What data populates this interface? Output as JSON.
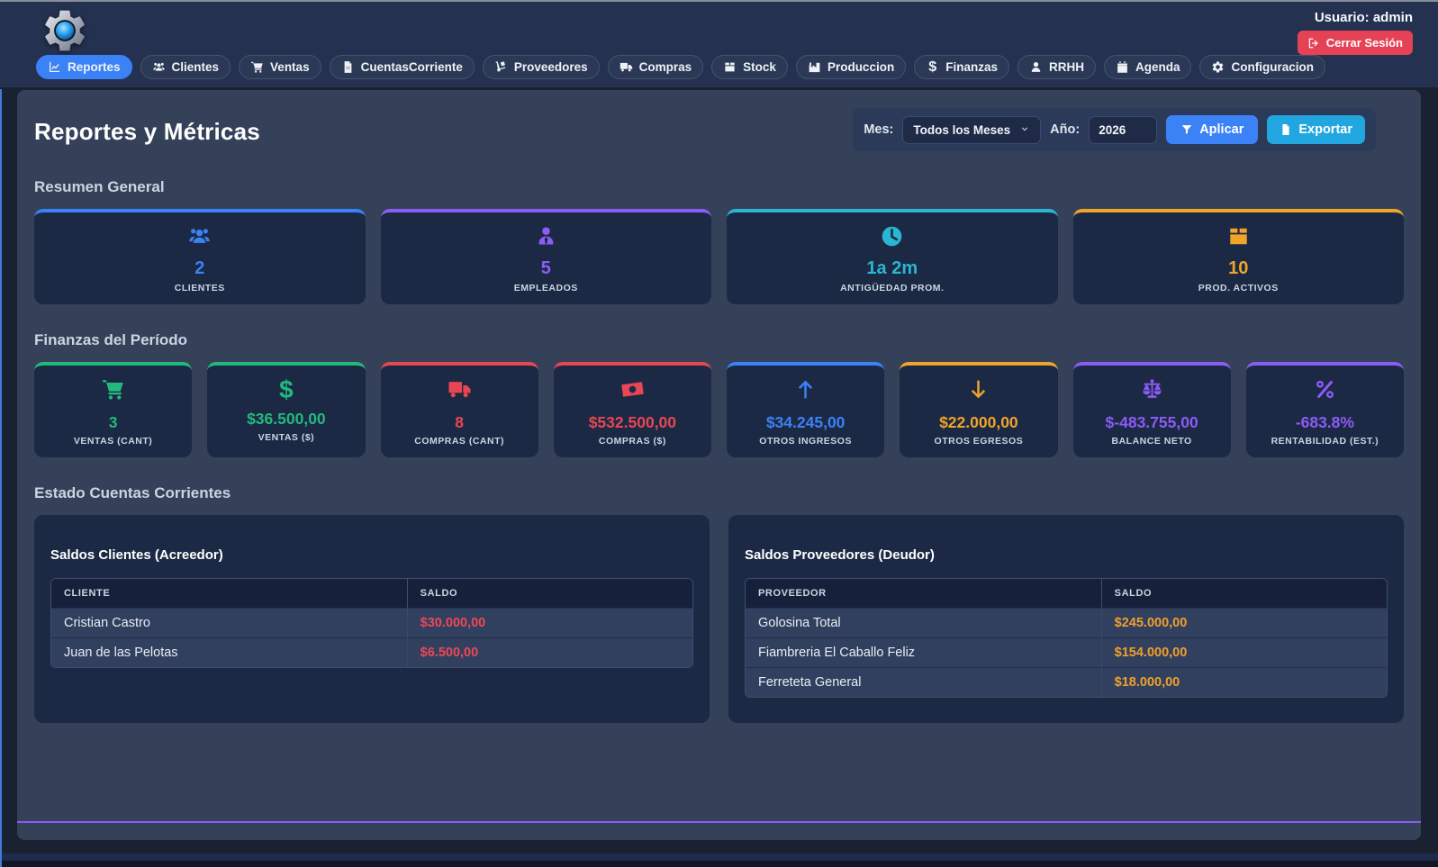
{
  "header": {
    "user_label": "Usuario: admin",
    "logout_label": "Cerrar Sesión",
    "nav": [
      {
        "label": "Reportes",
        "icon": "chart-line",
        "active": true
      },
      {
        "label": "Clientes",
        "icon": "users",
        "active": false
      },
      {
        "label": "Ventas",
        "icon": "cart",
        "active": false
      },
      {
        "label": "CuentasCorriente",
        "icon": "file-invoice",
        "active": false
      },
      {
        "label": "Proveedores",
        "icon": "dolly",
        "active": false
      },
      {
        "label": "Compras",
        "icon": "truck",
        "active": false
      },
      {
        "label": "Stock",
        "icon": "box",
        "active": false
      },
      {
        "label": "Produccion",
        "icon": "industry",
        "active": false
      },
      {
        "label": "Finanzas",
        "icon": "dollar",
        "active": false
      },
      {
        "label": "RRHH",
        "icon": "user",
        "active": false
      },
      {
        "label": "Agenda",
        "icon": "calendar",
        "active": false
      },
      {
        "label": "Configuracion",
        "icon": "gear",
        "active": false
      }
    ]
  },
  "icons": {
    "logout": "logout",
    "filter": "filter",
    "export_pdf": "file-pdf",
    "select_chevron": "chevron-down"
  },
  "colors": {
    "divider_purple": "#8b5cf6",
    "apply_blue": "#3b82f6",
    "export_blue": "#21a6e0",
    "logout_red": "#e64256"
  },
  "page": {
    "title": "Reportes y Métricas",
    "filters": {
      "month_label": "Mes:",
      "month_value": "Todos los Meses",
      "year_label": "Año:",
      "year_value": "2026",
      "apply_label": "Aplicar",
      "export_label": "Exportar"
    },
    "sections": {
      "summary_title": "Resumen General",
      "finance_title": "Finanzas del Período",
      "accounts_title": "Estado Cuentas Corrientes"
    },
    "summary_cards": [
      {
        "icon": "users",
        "value": "2",
        "label": "CLIENTES",
        "color": "#3b82f6"
      },
      {
        "icon": "user-tie",
        "value": "5",
        "label": "EMPLEADOS",
        "color": "#8b5cf6"
      },
      {
        "icon": "clock",
        "value": "1a 2m",
        "label": "ANTIGÜEDAD PROM.",
        "color": "#29b6d2"
      },
      {
        "icon": "box",
        "value": "10",
        "label": "PROD. ACTIVOS",
        "color": "#f0a429"
      }
    ],
    "finance_cards": [
      {
        "icon": "cart",
        "value": "3",
        "label": "VENTAS (CANT)",
        "color": "#22b97c"
      },
      {
        "icon": "dollar",
        "value": "$36.500,00",
        "label": "VENTAS ($)",
        "color": "#22b97c"
      },
      {
        "icon": "truck",
        "value": "8",
        "label": "COMPRAS (CANT)",
        "color": "#e94653"
      },
      {
        "icon": "money-bill",
        "value": "$532.500,00",
        "label": "COMPRAS ($)",
        "color": "#e94653"
      },
      {
        "icon": "arrow-up",
        "value": "$34.245,00",
        "label": "OTROS INGRESOS",
        "color": "#3b82f6"
      },
      {
        "icon": "arrow-down",
        "value": "$22.000,00",
        "label": "OTROS EGRESOS",
        "color": "#f0a429"
      },
      {
        "icon": "balance-scale",
        "value": "$-483.755,00",
        "label": "BALANCE NETO",
        "color": "#8b5cf6"
      },
      {
        "icon": "percent",
        "value": "-683.8%",
        "label": "RENTABILIDAD (EST.)",
        "color": "#8b5cf6"
      }
    ],
    "tables": [
      {
        "title": "Saldos Clientes (Acreedor)",
        "columns": [
          "CLIENTE",
          "SALDO"
        ],
        "amount_color": "#ee4757",
        "rows": [
          [
            "Cristian Castro",
            "$30.000,00"
          ],
          [
            "Juan de las Pelotas",
            "$6.500,00"
          ]
        ]
      },
      {
        "title": "Saldos Proveedores (Deudor)",
        "columns": [
          "PROVEEDOR",
          "SALDO"
        ],
        "amount_color": "#f0a02c",
        "rows": [
          [
            "Golosina Total",
            "$245.000,00"
          ],
          [
            "Fiambreria El Caballo Feliz",
            "$154.000,00"
          ],
          [
            "Ferreteta General",
            "$18.000,00"
          ]
        ]
      }
    ]
  }
}
